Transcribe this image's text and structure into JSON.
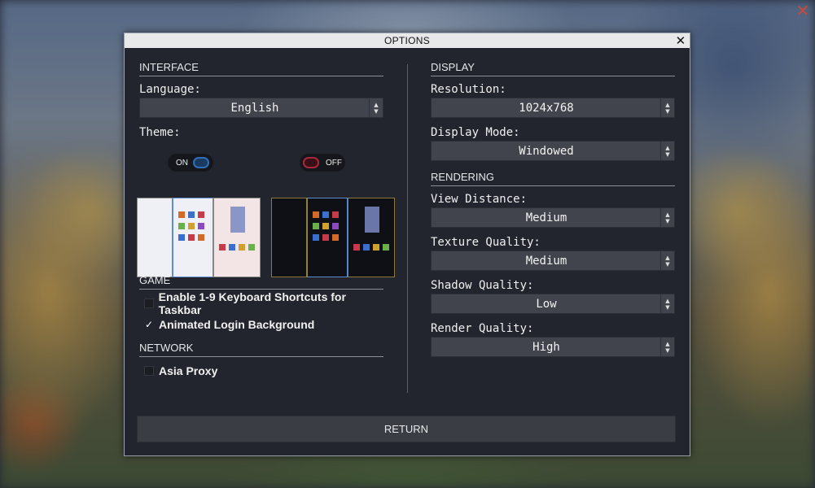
{
  "dialog": {
    "title": "OPTIONS",
    "return_label": "RETURN"
  },
  "interface": {
    "heading": "INTERFACE",
    "language_label": "Language:",
    "language_value": "English",
    "theme_label": "Theme:",
    "theme_light_toggle": "ON",
    "theme_dark_toggle": "OFF"
  },
  "game": {
    "heading": "GAME",
    "options": [
      {
        "label": "Enable 1-9 Keyboard Shortcuts for Taskbar",
        "checked": false
      },
      {
        "label": "Animated Login Background",
        "checked": true
      }
    ]
  },
  "network": {
    "heading": "NETWORK",
    "options": [
      {
        "label": "Asia Proxy",
        "checked": false
      }
    ]
  },
  "display": {
    "heading": "DISPLAY",
    "resolution_label": "Resolution:",
    "resolution_value": "1024x768",
    "mode_label": "Display Mode:",
    "mode_value": "Windowed"
  },
  "rendering": {
    "heading": "RENDERING",
    "view_label": "View Distance:",
    "view_value": "Medium",
    "texture_label": "Texture Quality:",
    "texture_value": "Medium",
    "shadow_label": "Shadow Quality:",
    "shadow_value": "Low",
    "render_label": "Render Quality:",
    "render_value": "High"
  },
  "icons": {
    "close": "close-icon",
    "checkmark": "checkmark-icon",
    "select_arrows": "up-down-arrows-icon"
  },
  "colors": {
    "toggle_on": "#2f6fb5",
    "toggle_off": "#a8293a",
    "panel_bg": "#23252e"
  }
}
